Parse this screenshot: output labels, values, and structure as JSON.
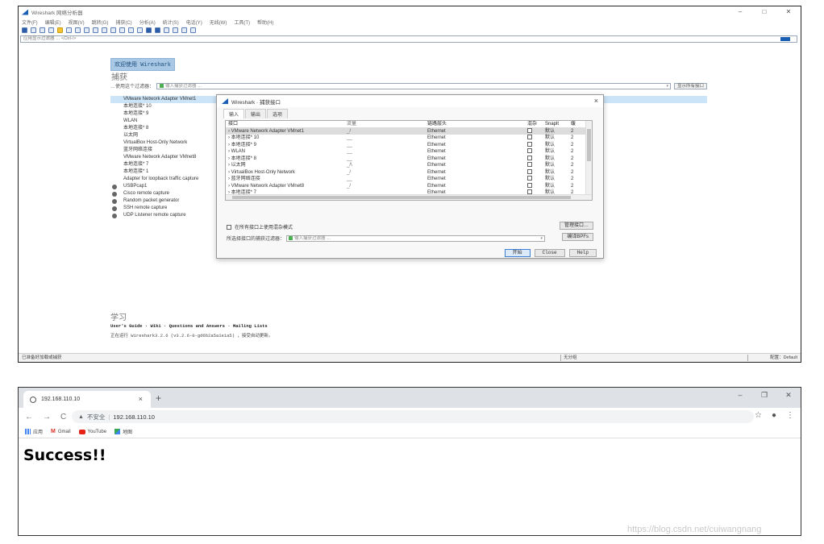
{
  "wireshark": {
    "title": "Wireshark 网络分析器",
    "menu": [
      "文件(F)",
      "编辑(E)",
      "视图(V)",
      "跳转(G)",
      "捕获(C)",
      "分析(A)",
      "统计(S)",
      "电话(Y)",
      "无线(W)",
      "工具(T)",
      "帮助(H)"
    ],
    "display_filter_placeholder": "应用显示过滤器 … <Ctrl-/>",
    "welcome_label": "欢迎使用 Wireshark",
    "capture_heading": "捕获",
    "capture_filter_label": "…使用这个过滤器：",
    "capture_filter_placeholder": "输入捕获过滤器 …",
    "show_all_label": "显示所有接口",
    "interfaces": [
      {
        "name": "VMware Network Adapter VMnet1",
        "selected": true
      },
      {
        "name": "本地连接* 10"
      },
      {
        "name": "本地连接* 9"
      },
      {
        "name": "WLAN"
      },
      {
        "name": "本地连接* 8"
      },
      {
        "name": "以太网"
      },
      {
        "name": "VirtualBox Host-Only Network"
      },
      {
        "name": "蓝牙网络连接"
      },
      {
        "name": "VMware Network Adapter VMnet8"
      },
      {
        "name": "本地连接* 7"
      },
      {
        "name": "本地连接* 1"
      },
      {
        "name": "Adapter for loopback traffic capture"
      },
      {
        "name": "USBPcap1",
        "external": true
      },
      {
        "name": "Cisco remote capture",
        "external": true
      },
      {
        "name": "Random packet generator",
        "external": true
      },
      {
        "name": "SSH remote capture",
        "external": true
      },
      {
        "name": "UDP Listener remote capture",
        "external": true
      }
    ],
    "learn_heading": "学习",
    "learn_links": "User's Guide · Wiki · Questions and Answers · Mailing Lists",
    "version_text": "正在运行 Wireshark3.2.6 (v3.2.6-0-gd6b2a5a1e1a5) ，接受自动更新。",
    "status_left": "已准备好加载或捕获",
    "status_mid": "无分组",
    "status_right": "配置：Default"
  },
  "dialog": {
    "title": "Wireshark · 捕获接口",
    "close": "×",
    "tabs": [
      "输入",
      "输出",
      "选项"
    ],
    "columns": [
      "接口",
      "流量",
      "链路层头",
      "混杂",
      "Snaplt",
      "缓"
    ],
    "rows": [
      {
        "iface": "VMware Network Adapter VMnet1",
        "traffic": "_/",
        "link": "Ethernet",
        "snap": "默认",
        "buf": "2"
      },
      {
        "iface": "本地连接* 10",
        "traffic": "__",
        "link": "Ethernet",
        "snap": "默认",
        "buf": "2"
      },
      {
        "iface": "本地连接* 9",
        "traffic": "__",
        "link": "Ethernet",
        "snap": "默认",
        "buf": "2"
      },
      {
        "iface": "WLAN",
        "traffic": "__",
        "link": "Ethernet",
        "snap": "默认",
        "buf": "2"
      },
      {
        "iface": "本地连接* 8",
        "traffic": "__",
        "link": "Ethernet",
        "snap": "默认",
        "buf": "2"
      },
      {
        "iface": "以太网",
        "traffic": "_/\\",
        "link": "Ethernet",
        "snap": "默认",
        "buf": "2"
      },
      {
        "iface": "VirtualBox Host-Only Network",
        "traffic": "_/",
        "link": "Ethernet",
        "snap": "默认",
        "buf": "2"
      },
      {
        "iface": "蓝牙网络连接",
        "traffic": "__",
        "link": "Ethernet",
        "snap": "默认",
        "buf": "2"
      },
      {
        "iface": "VMware Network Adapter VMnet8",
        "traffic": "_/",
        "link": "Ethernet",
        "snap": "默认",
        "buf": "2"
      },
      {
        "iface": "本地连接* 7",
        "traffic": "__",
        "link": "Ethernet",
        "snap": "默认",
        "buf": "2"
      }
    ],
    "promisc_label": "在所有接口上使用混杂模式",
    "manage_label": "管理接口…",
    "filter_label": "所选择接口的捕获过滤器：",
    "filter_placeholder": "输入捕获过滤器 …",
    "compile_label": "编译BPFs",
    "start_label": "开始",
    "close_label": "Close",
    "help_label": "Help"
  },
  "browser": {
    "tab_title": "192.168.110.10",
    "tab_close": "×",
    "new_tab": "+",
    "insecure_label": "不安全",
    "url": "192.168.110.10",
    "bookmarks": [
      "应用",
      "Gmail",
      "YouTube",
      "地图"
    ],
    "page_heading": "Success!!"
  },
  "watermark": "https://blog.csdn.net/cuiwangnang"
}
